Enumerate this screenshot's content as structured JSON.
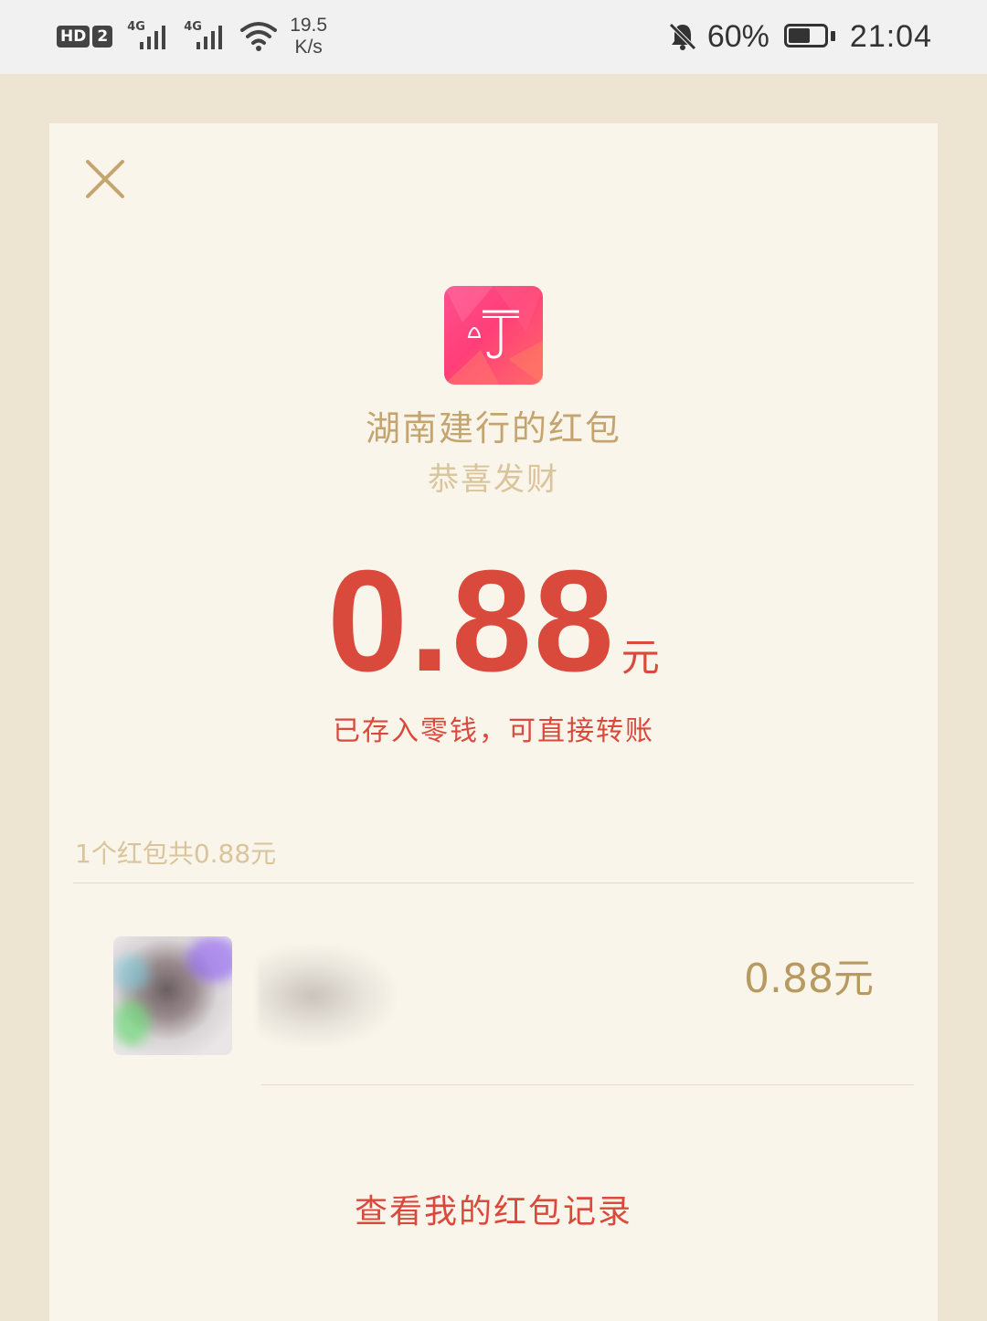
{
  "status_bar": {
    "hd_label": "HD",
    "sim_label": "2",
    "signal1_label": "4G",
    "signal2_label": "4G",
    "net_speed_value": "19.5",
    "net_speed_unit": "K/s",
    "battery_percent": "60%",
    "battery_level": 0.6,
    "time": "21:04",
    "icons": [
      "hd-icon",
      "signal-icon",
      "signal-icon",
      "wifi-icon",
      "mute-bell-icon",
      "battery-icon"
    ]
  },
  "packet": {
    "close_icon": "close-icon",
    "app_icon": "app-logo-icon",
    "sender_title": "湖南建行的红包",
    "greeting": "恭喜发财",
    "amount": "0.88",
    "amount_unit": "元",
    "stored_note": "已存入零钱，可直接转账",
    "summary": "1个红包共0.88元"
  },
  "receivers": [
    {
      "avatar": "avatar",
      "amount": "0.88元"
    }
  ],
  "footer": {
    "record_link": "查看我的红包记录"
  },
  "colors": {
    "accent_red": "#d9493c",
    "gold": "#c4a570",
    "card_bg": "#faf5ea",
    "page_bg": "#ede4d2"
  }
}
